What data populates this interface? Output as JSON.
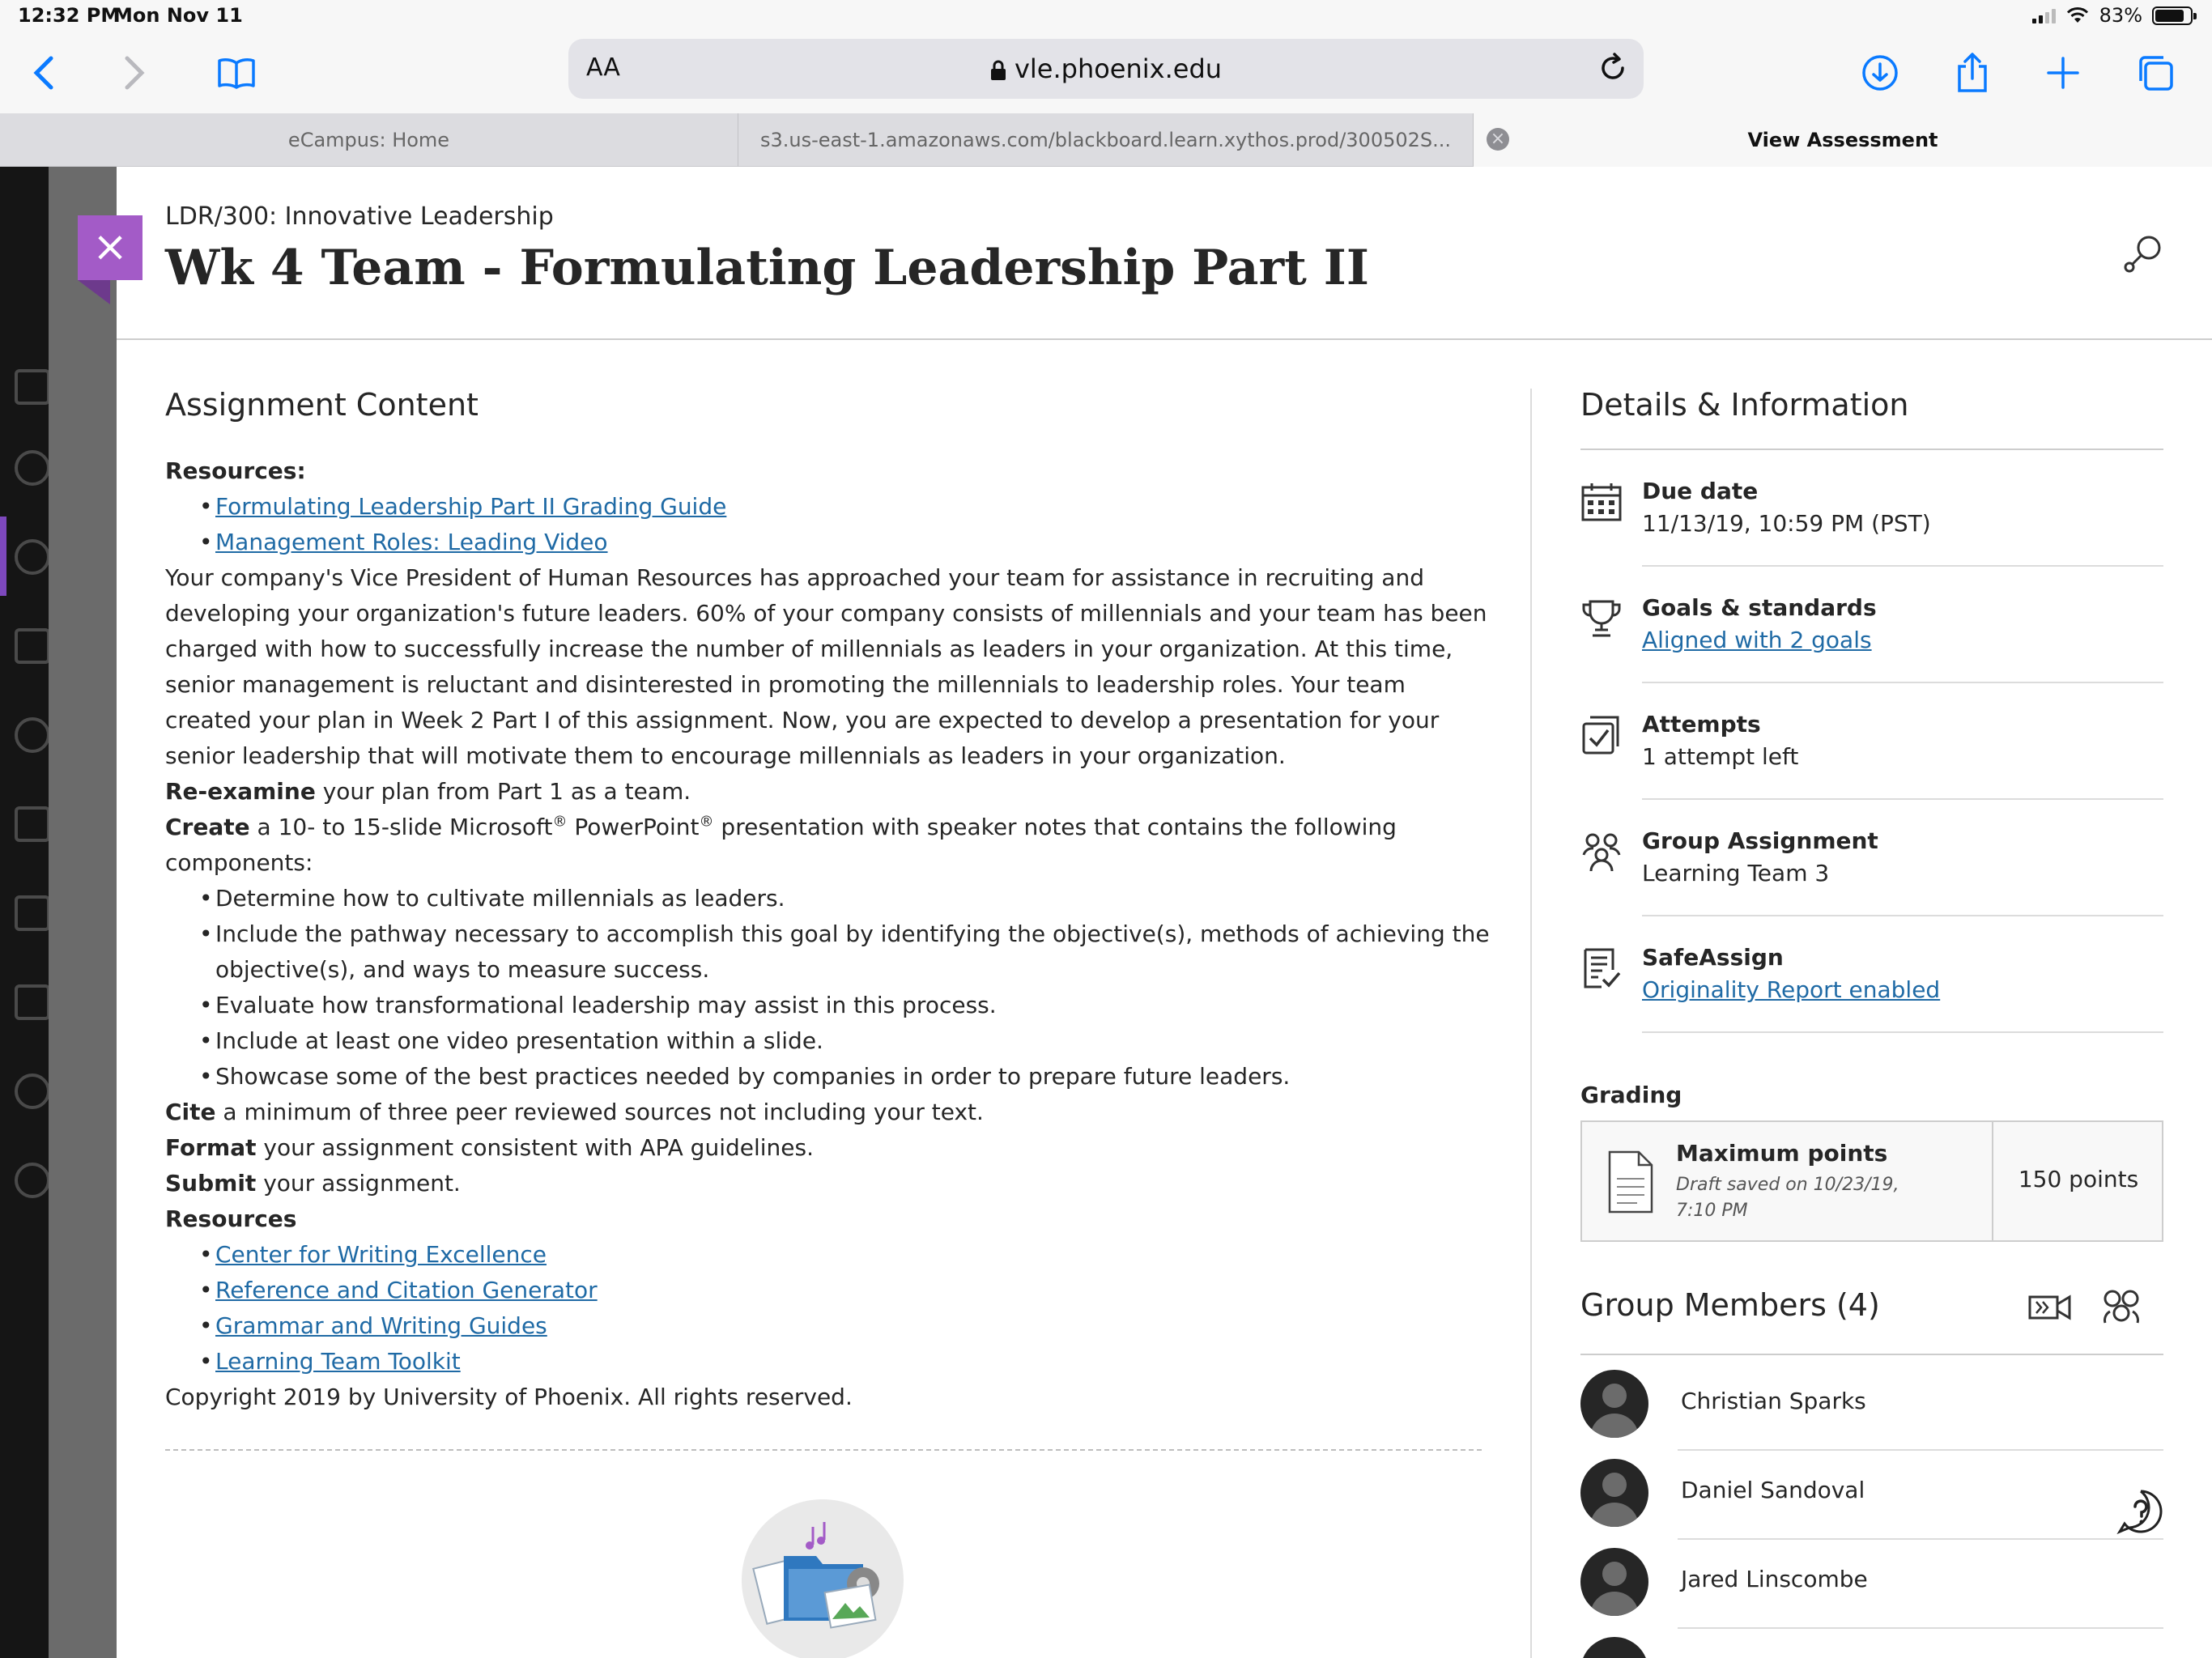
{
  "status_bar": {
    "time": "12:32 PM",
    "date": "Mon Nov 11",
    "battery": "83%",
    "battery_level": 0.83
  },
  "browser": {
    "text_size_label": "AA",
    "url": "vle.phoenix.edu",
    "tabs": [
      {
        "label": "eCampus: Home"
      },
      {
        "label": "s3.us-east-1.amazonaws.com/blackboard.learn.xythos.prod/300502S..."
      },
      {
        "label": "View Assessment"
      }
    ]
  },
  "header": {
    "course": "LDR/300: Innovative Leadership",
    "title": "Wk 4 Team - Formulating Leadership Part II"
  },
  "content": {
    "heading": "Assignment Content",
    "resources_label": "Resources:",
    "resource_links": [
      "Formulating Leadership Part II Grading Guide",
      "Management Roles: Leading Video"
    ],
    "intro": "Your company's Vice President of Human Resources has approached your team for assistance in recruiting and developing your organization's future leaders. 60% of your company consists of millennials and your team has been charged with how to successfully increase the number of millennials as leaders in your organization. At this time, senior management is reluctant and disinterested in promoting the millennials to leadership roles. Your team created your plan in Week 2 Part I of this assignment. Now, you are expected to develop a presentation for your senior leadership that will motivate them to encourage millennials as leaders in your organization.",
    "reexamine_bold": "Re-examine",
    "reexamine_rest": " your plan from Part 1 as a team.",
    "create_bold": "Create",
    "create_part1": " a 10- to 15-slide Microsoft",
    "create_part2": " PowerPoint",
    "create_part3": " presentation with speaker notes that contains the following components:",
    "registered_mark": "®",
    "components": [
      "Determine how to cultivate millennials as leaders.",
      "Include the pathway necessary to accomplish this goal by identifying the objective(s), methods of achieving the objective(s), and ways to measure success.",
      "Evaluate how transformational leadership may assist in this process.",
      "Include at least one video presentation within a slide.",
      "Showcase some of the best practices needed by companies in order to prepare future leaders."
    ],
    "cite_bold": "Cite",
    "cite_rest": " a minimum of three peer reviewed sources not including your text.",
    "format_bold": "Format",
    "format_rest": " your assignment consistent with APA guidelines.",
    "submit_bold": "Submit",
    "submit_rest": " your assignment.",
    "resources2_label": "Resources",
    "resource_links2": [
      "Center for Writing Excellence",
      "Reference and Citation Generator",
      "Grammar and Writing Guides",
      "Learning Team Toolkit"
    ],
    "copyright": "Copyright 2019 by University of Phoenix. All rights reserved."
  },
  "details": {
    "heading": "Details & Information",
    "due_label": "Due date",
    "due_value": "11/13/19, 10:59 PM (PST)",
    "goals_label": "Goals & standards",
    "goals_value": "Aligned with 2 goals",
    "attempts_label": "Attempts",
    "attempts_value": "1 attempt left",
    "group_label": "Group Assignment",
    "group_value": "Learning Team 3",
    "safeassign_label": "SafeAssign",
    "safeassign_value": "Originality Report enabled"
  },
  "grading": {
    "label": "Grading",
    "max_label": "Maximum points",
    "draft": "Draft saved on 10/23/19, 7:10 PM",
    "points": "150 points"
  },
  "members": {
    "title": "Group Members (4)",
    "list": [
      "Christian Sparks",
      "Daniel Sandoval",
      "Jared Linscombe"
    ]
  },
  "colors": {
    "accent": "#a35bc7",
    "link": "#1f6aa5",
    "ios_blue": "#0a7aff",
    "nav_bg": "#151515"
  }
}
